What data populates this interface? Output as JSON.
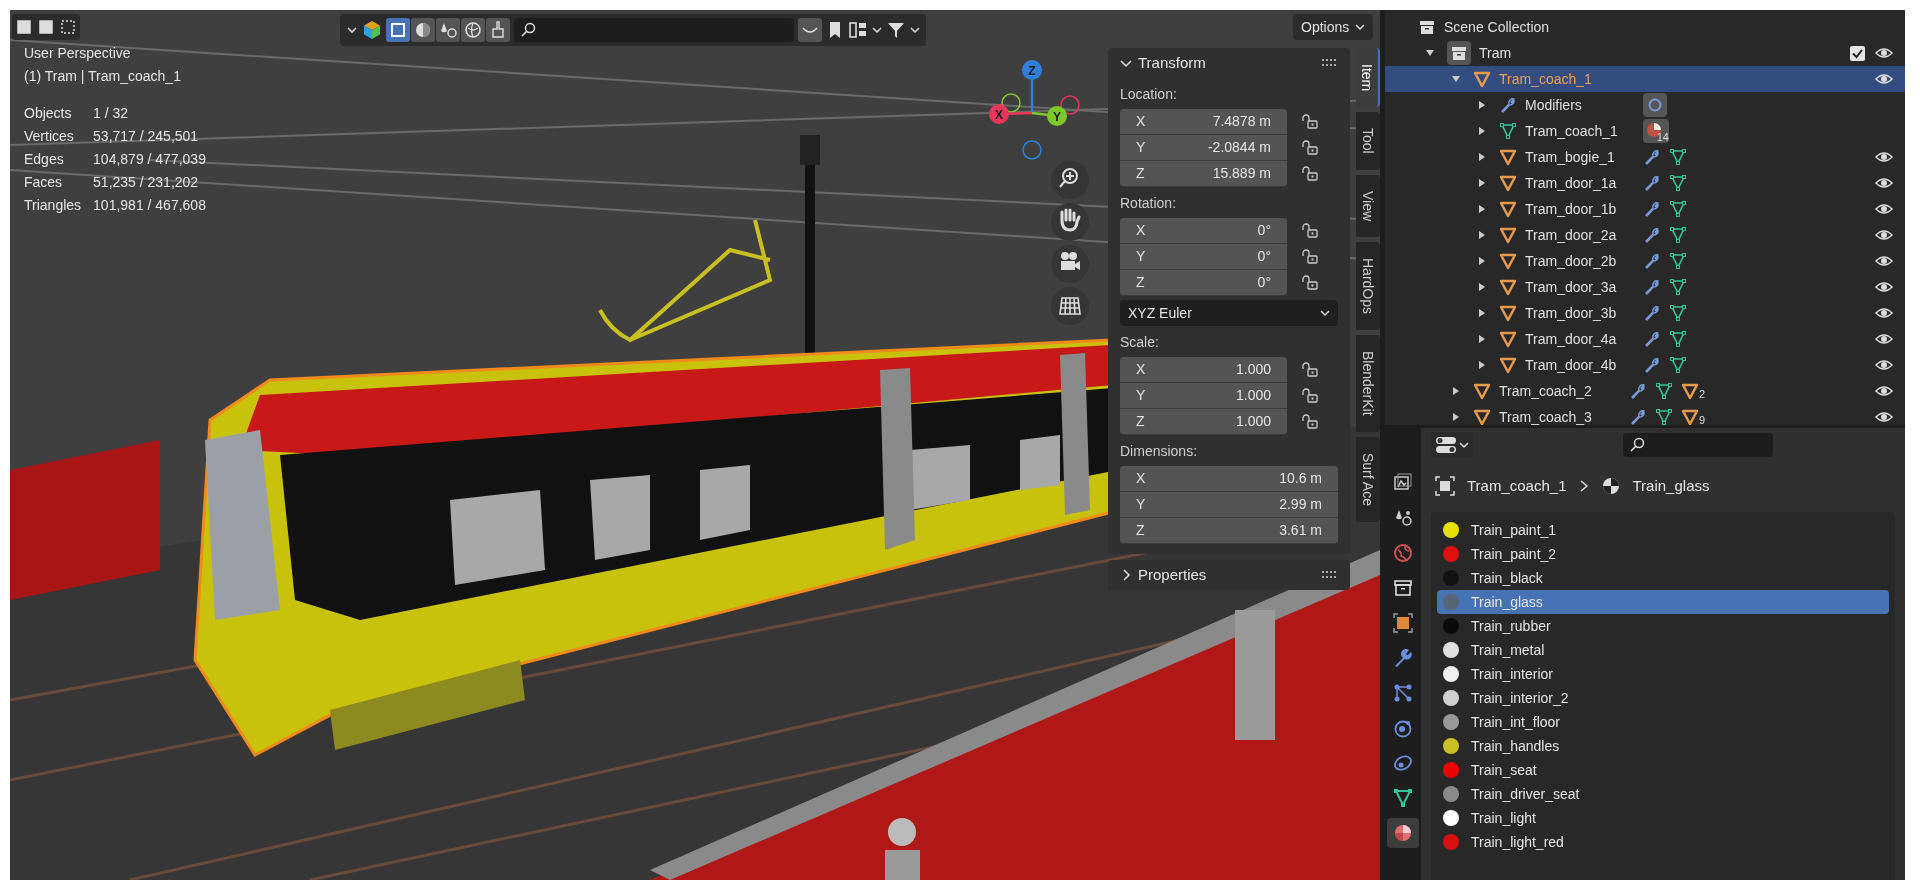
{
  "viewport_header": {
    "options_label": "Options"
  },
  "viewport": {
    "view_name": "User Perspective",
    "context": "(1) Tram | Tram_coach_1",
    "stats": [
      {
        "label": "Objects",
        "value": "1 / 32"
      },
      {
        "label": "Vertices",
        "value": "53,717 / 245,501"
      },
      {
        "label": "Edges",
        "value": "104,879 / 477,039"
      },
      {
        "label": "Faces",
        "value": "51,235 / 231,202"
      },
      {
        "label": "Triangles",
        "value": "101,981 / 467,608"
      }
    ],
    "gizmo": [
      {
        "label": "Z",
        "color": "#2f7fdc"
      },
      {
        "label": "X",
        "color": "#e8365a"
      },
      {
        "label": "Y",
        "color": "#7ec829"
      }
    ]
  },
  "transform_panel": {
    "title": "Transform",
    "expanded": true,
    "sections": [
      {
        "kind": "vector",
        "label": "Location:",
        "fields": [
          {
            "axis": "X",
            "value": "7.4878 m",
            "locked": false
          },
          {
            "axis": "Y",
            "value": "-2.0844 m",
            "locked": false
          },
          {
            "axis": "Z",
            "value": "15.889 m",
            "locked": false
          }
        ]
      },
      {
        "kind": "vector",
        "label": "Rotation:",
        "fields": [
          {
            "axis": "X",
            "value": "0°",
            "locked": false
          },
          {
            "axis": "Y",
            "value": "0°",
            "locked": false
          },
          {
            "axis": "Z",
            "value": "0°",
            "locked": false
          }
        ]
      },
      {
        "kind": "dropdown",
        "value": "XYZ Euler"
      },
      {
        "kind": "vector",
        "label": "Scale:",
        "fields": [
          {
            "axis": "X",
            "value": "1.000",
            "locked": false
          },
          {
            "axis": "Y",
            "value": "1.000",
            "locked": false
          },
          {
            "axis": "Z",
            "value": "1.000",
            "locked": false
          }
        ]
      },
      {
        "kind": "vector",
        "label": "Dimensions:",
        "fields": [
          {
            "axis": "X",
            "value": "10.6 m"
          },
          {
            "axis": "Y",
            "value": "2.99 m"
          },
          {
            "axis": "Z",
            "value": "3.61 m"
          }
        ]
      }
    ]
  },
  "properties_panel": {
    "title": "Properties",
    "expanded": false
  },
  "sidebar_tabs": [
    {
      "label": "Item",
      "selected": true
    },
    {
      "label": "Tool",
      "selected": false
    },
    {
      "label": "View",
      "selected": false
    },
    {
      "label": "HardOps",
      "selected": false
    },
    {
      "label": "BlenderKit",
      "selected": false
    },
    {
      "label": "Surf Ace",
      "selected": false
    }
  ],
  "outliner": {
    "title": "Scene Collection",
    "items": [
      {
        "kind": "collection",
        "name": "Tram",
        "expanded": true,
        "selected": false,
        "enabled": true,
        "visible": true,
        "children": [
          {
            "kind": "object",
            "name": "Tram_coach_1",
            "expanded": true,
            "selected": true,
            "visible": true,
            "children": [
              {
                "kind": "modifiers",
                "name": "Modifiers",
                "expanded": false,
                "selected": false,
                "badges": [
                  {
                    "kind": "modifier"
                  }
                ]
              },
              {
                "kind": "mesh",
                "name": "Tram_coach_1",
                "expanded": false,
                "selected": false,
                "badges": [
                  {
                    "kind": "material",
                    "count": "14"
                  }
                ]
              },
              {
                "kind": "object",
                "name": "Tram_bogie_1",
                "expanded": false,
                "selected": false,
                "visible": true,
                "badges": [
                  {
                    "kind": "wrench"
                  },
                  {
                    "kind": "mesh"
                  }
                ]
              },
              {
                "kind": "object",
                "name": "Tram_door_1a",
                "expanded": false,
                "selected": false,
                "visible": true,
                "badges": [
                  {
                    "kind": "wrench"
                  },
                  {
                    "kind": "mesh"
                  }
                ]
              },
              {
                "kind": "object",
                "name": "Tram_door_1b",
                "expanded": false,
                "selected": false,
                "visible": true,
                "badges": [
                  {
                    "kind": "wrench"
                  },
                  {
                    "kind": "mesh"
                  }
                ]
              },
              {
                "kind": "object",
                "name": "Tram_door_2a",
                "expanded": false,
                "selected": false,
                "visible": true,
                "badges": [
                  {
                    "kind": "wrench"
                  },
                  {
                    "kind": "mesh"
                  }
                ]
              },
              {
                "kind": "object",
                "name": "Tram_door_2b",
                "expanded": false,
                "selected": false,
                "visible": true,
                "badges": [
                  {
                    "kind": "wrench"
                  },
                  {
                    "kind": "mesh"
                  }
                ]
              },
              {
                "kind": "object",
                "name": "Tram_door_3a",
                "expanded": false,
                "selected": false,
                "visible": true,
                "badges": [
                  {
                    "kind": "wrench"
                  },
                  {
                    "kind": "mesh"
                  }
                ]
              },
              {
                "kind": "object",
                "name": "Tram_door_3b",
                "expanded": false,
                "selected": false,
                "visible": true,
                "badges": [
                  {
                    "kind": "wrench"
                  },
                  {
                    "kind": "mesh"
                  }
                ]
              },
              {
                "kind": "object",
                "name": "Tram_door_4a",
                "expanded": false,
                "selected": false,
                "visible": true,
                "badges": [
                  {
                    "kind": "wrench"
                  },
                  {
                    "kind": "mesh"
                  }
                ]
              },
              {
                "kind": "object",
                "name": "Tram_door_4b",
                "expanded": false,
                "selected": false,
                "visible": true,
                "badges": [
                  {
                    "kind": "wrench"
                  },
                  {
                    "kind": "mesh"
                  }
                ]
              }
            ]
          },
          {
            "kind": "object",
            "name": "Tram_coach_2",
            "expanded": false,
            "selected": false,
            "visible": true,
            "badges": [
              {
                "kind": "wrench"
              },
              {
                "kind": "mesh"
              },
              {
                "kind": "object",
                "count": "2"
              }
            ]
          },
          {
            "kind": "object",
            "name": "Tram_coach_3",
            "expanded": false,
            "selected": false,
            "visible": true,
            "badges": [
              {
                "kind": "wrench"
              },
              {
                "kind": "mesh"
              },
              {
                "kind": "object",
                "count": "9"
              }
            ]
          }
        ]
      }
    ]
  },
  "properties_editor": {
    "tabs": [
      {
        "kind": "output",
        "selected": false
      },
      {
        "kind": "scene",
        "selected": false
      },
      {
        "kind": "world",
        "selected": false
      },
      {
        "kind": "collection",
        "selected": false
      },
      {
        "kind": "object",
        "selected": false
      },
      {
        "kind": "modifiers",
        "selected": false
      },
      {
        "kind": "particles",
        "selected": false
      },
      {
        "kind": "physics",
        "selected": false
      },
      {
        "kind": "constraints",
        "selected": false
      },
      {
        "kind": "data",
        "selected": false
      },
      {
        "kind": "material",
        "selected": true
      }
    ],
    "breadcrumb": [
      {
        "kind": "object",
        "label": "Tram_coach_1"
      },
      {
        "kind": "material",
        "label": "Train_glass"
      }
    ],
    "materials": [
      {
        "name": "Train_paint_1",
        "color": "#e8e000",
        "selected": false
      },
      {
        "name": "Train_paint_2",
        "color": "#e01010",
        "selected": false
      },
      {
        "name": "Train_black",
        "color": "#111111",
        "selected": false
      },
      {
        "name": "Train_glass",
        "color": "#556677",
        "selected": true
      },
      {
        "name": "Train_rubber",
        "color": "#0a0a0a",
        "selected": false
      },
      {
        "name": "Train_metal",
        "color": "#e0e0e0",
        "selected": false
      },
      {
        "name": "Train_interior",
        "color": "#f0f0f0",
        "selected": false
      },
      {
        "name": "Train_interior_2",
        "color": "#d0d0d0",
        "selected": false
      },
      {
        "name": "Train_int_floor",
        "color": "#999999",
        "selected": false
      },
      {
        "name": "Train_handles",
        "color": "#c8c020",
        "selected": false
      },
      {
        "name": "Train_seat",
        "color": "#ee0000",
        "selected": false
      },
      {
        "name": "Train_driver_seat",
        "color": "#8a8a8a",
        "selected": false
      },
      {
        "name": "Train_light",
        "color": "#ffffff",
        "selected": false
      },
      {
        "name": "Train_light_red",
        "color": "#d81010",
        "selected": false
      }
    ]
  }
}
